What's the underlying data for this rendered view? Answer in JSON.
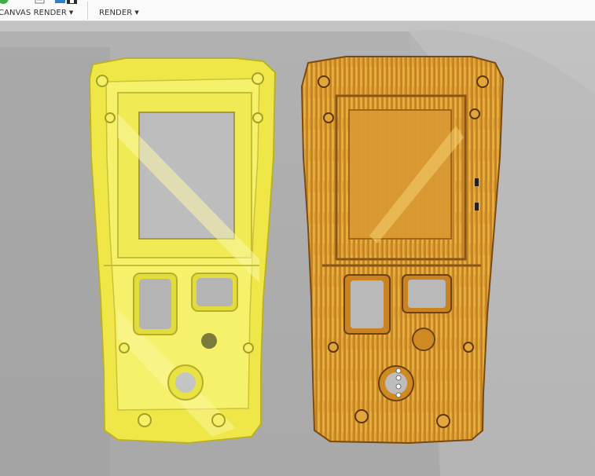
{
  "toolbar": {
    "groups": [
      {
        "label": "CANVAS RENDER",
        "has_dropdown": true
      },
      {
        "label": "RENDER",
        "has_dropdown": true
      }
    ],
    "icons": [
      "status-check-icon",
      "document-icon",
      "monitor-icon",
      "render-save-icon"
    ]
  },
  "viewport": {
    "background_color": "#bdbdbd",
    "shadow_color": "#8e8e8e",
    "models": [
      {
        "name": "housing-front-part",
        "color": "#f1ec4a"
      },
      {
        "name": "housing-rear-part",
        "color": "#e4a93a"
      }
    ]
  }
}
